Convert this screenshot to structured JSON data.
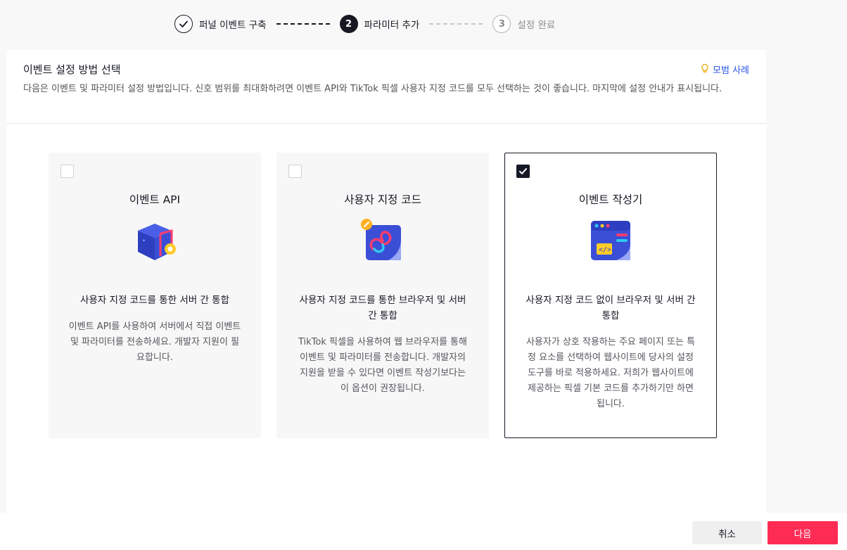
{
  "stepper": {
    "steps": [
      {
        "number": "",
        "label": "퍼널 이벤트 구축",
        "state": "done"
      },
      {
        "number": "2",
        "label": "파라미터 추가",
        "state": "active"
      },
      {
        "number": "3",
        "label": "설정 완료",
        "state": "pending"
      }
    ]
  },
  "panel": {
    "title": "이벤트 설정 방법 선택",
    "sample_link": "모범 사례",
    "description": "다음은 이벤트 및 파라미터 설정 방법입니다. 신호 범위를 최대화하려면 이벤트 API와 TikTok 픽셀 사용자 지정 코드를 모두 선택하는 것이 좋습니다. 마지막에 설정 안내가 표시됩니다."
  },
  "cards": [
    {
      "title": "이벤트 API",
      "subtitle": "사용자 지정 코드를 통한 서버 간 통합",
      "body": "이벤트 API를 사용하여 서버에서 직접 이벤트 및 파라미터를 전송하세요. 개발자 지원이 필요합니다.",
      "checked": false,
      "icon": "cube-api-icon"
    },
    {
      "title": "사용자 지정 코드",
      "subtitle": "사용자 지정 코드를 통한 브라우저 및 서버 간 통합",
      "body": "TikTok 픽셀을 사용하여 웹 브라우저를 통해 이벤트 및 파라미터를 전송합니다. 개발자의 지원을 받을 수 있다면 이벤트 작성기보다는 이 옵션이 권장됩니다.",
      "checked": false,
      "icon": "custom-code-icon"
    },
    {
      "title": "이벤트 작성기",
      "subtitle": "사용자 지정 코드 없이 브라우저 및 서버 간 통합",
      "body": "사용자가 상호 작용하는 주요 페이지 또는 특정 요소를 선택하여 웹사이트에 당사의 설정 도구를 바로 적용하세요. 저희가 웹사이트에 제공하는 픽셀 기본 코드를 추가하기만 하면 됩니다.",
      "checked": true,
      "icon": "event-builder-icon"
    }
  ],
  "footer": {
    "cancel_label": "취소",
    "next_label": "다음"
  },
  "colors": {
    "accent": "#fe2c55",
    "link": "#2a55e5",
    "text": "#161823"
  }
}
